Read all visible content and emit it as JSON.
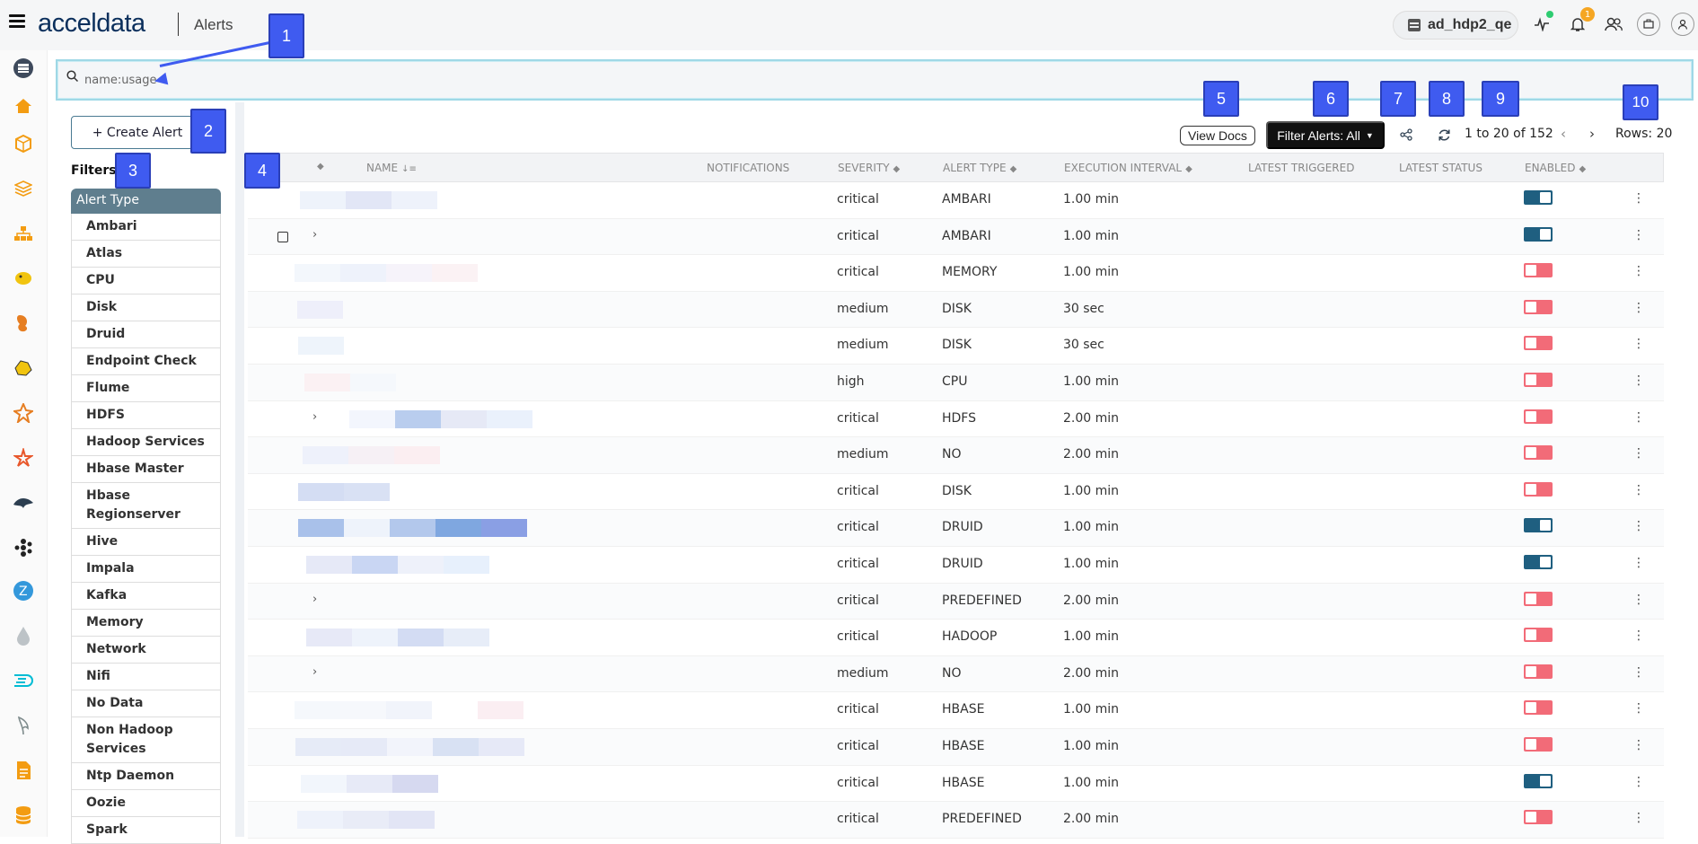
{
  "header": {
    "logo": "acceldata",
    "page_title": "Alerts",
    "cluster": "ad_hdp2_qe",
    "notification_count": "1"
  },
  "search": {
    "value": "",
    "placeholder": "name:usage"
  },
  "left_panel": {
    "create_button": "+ Create Alert",
    "filters_title": "Filters",
    "filter_group": "Alert Type",
    "alert_types": [
      "Ambari",
      "Atlas",
      "CPU",
      "Disk",
      "Druid",
      "Endpoint Check",
      "Flume",
      "HDFS",
      "Hadoop Services",
      "Hbase Master",
      "Hbase Regionserver",
      "Hive",
      "Impala",
      "Kafka",
      "Memory",
      "Network",
      "Nifi",
      "No Data",
      "Non Hadoop Services",
      "Ntp Daemon",
      "Oozie",
      "Spark"
    ]
  },
  "toolbar": {
    "view_docs": "View Docs",
    "filter_alerts": "Filter Alerts: All",
    "pager": "1 to 20 of 152",
    "rows": "Rows: 20"
  },
  "table": {
    "columns": {
      "name": "NAME",
      "notifications": "NOTIFICATIONS",
      "severity": "SEVERITY",
      "alert_type": "ALERT TYPE",
      "interval": "EXECUTION INTERVAL",
      "latest_triggered": "LATEST TRIGGERED",
      "latest_status": "LATEST STATUS",
      "enabled": "ENABLED"
    },
    "rows": [
      {
        "severity": "critical",
        "type": "AMBARI",
        "interval": "1.00 min",
        "enabled": true
      },
      {
        "severity": "critical",
        "type": "AMBARI",
        "interval": "1.00 min",
        "enabled": true
      },
      {
        "severity": "critical",
        "type": "MEMORY",
        "interval": "1.00 min",
        "enabled": false
      },
      {
        "severity": "medium",
        "type": "DISK",
        "interval": "30 sec",
        "enabled": false
      },
      {
        "severity": "medium",
        "type": "DISK",
        "interval": "30 sec",
        "enabled": false
      },
      {
        "severity": "high",
        "type": "CPU",
        "interval": "1.00 min",
        "enabled": false
      },
      {
        "severity": "critical",
        "type": "HDFS",
        "interval": "2.00 min",
        "enabled": false
      },
      {
        "severity": "medium",
        "type": "NO",
        "interval": "2.00 min",
        "enabled": false
      },
      {
        "severity": "critical",
        "type": "DISK",
        "interval": "1.00 min",
        "enabled": false
      },
      {
        "severity": "critical",
        "type": "DRUID",
        "interval": "1.00 min",
        "enabled": true
      },
      {
        "severity": "critical",
        "type": "DRUID",
        "interval": "1.00 min",
        "enabled": true
      },
      {
        "severity": "critical",
        "type": "PREDEFINED",
        "interval": "2.00 min",
        "enabled": false
      },
      {
        "severity": "critical",
        "type": "HADOOP",
        "interval": "1.00 min",
        "enabled": false
      },
      {
        "severity": "medium",
        "type": "NO",
        "interval": "2.00 min",
        "enabled": false
      },
      {
        "severity": "critical",
        "type": "HBASE",
        "interval": "1.00 min",
        "enabled": false
      },
      {
        "severity": "critical",
        "type": "HBASE",
        "interval": "1.00 min",
        "enabled": false
      },
      {
        "severity": "critical",
        "type": "HBASE",
        "interval": "1.00 min",
        "enabled": true
      },
      {
        "severity": "critical",
        "type": "PREDEFINED",
        "interval": "2.00 min",
        "enabled": false
      }
    ]
  },
  "callouts": [
    "1",
    "2",
    "3",
    "4",
    "5",
    "6",
    "7",
    "8",
    "9",
    "10"
  ],
  "colors": {
    "callout": "#3f5bf0",
    "toggle_on": "#1f5f80",
    "toggle_off": "#f26b78",
    "filter_header": "#5f7e8e"
  }
}
